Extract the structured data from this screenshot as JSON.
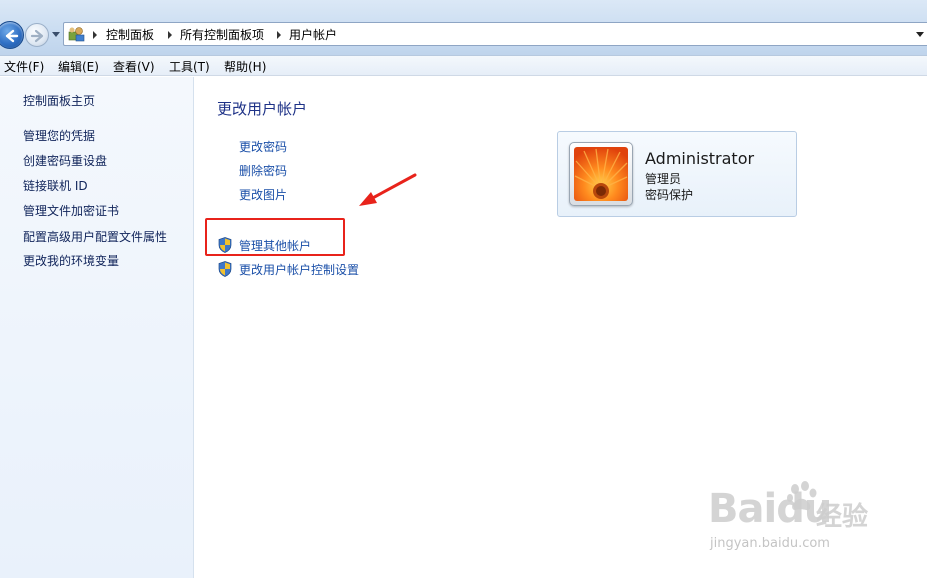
{
  "address_bar": {
    "breadcrumbs": [
      "控制面板",
      "所有控制面板项",
      "用户帐户"
    ]
  },
  "menu": {
    "items": [
      "文件(F)",
      "编辑(E)",
      "查看(V)",
      "工具(T)",
      "帮助(H)"
    ]
  },
  "sidebar": {
    "home": "控制面板主页",
    "links": [
      "管理您的凭据",
      "创建密码重设盘",
      "链接联机 ID",
      "管理文件加密证书",
      "配置高级用户配置文件属性",
      "更改我的环境变量"
    ]
  },
  "main": {
    "title": "更改用户帐户",
    "tasks": [
      "更改密码",
      "删除密码",
      "更改图片"
    ],
    "admin_tasks": [
      "管理其他帐户",
      "更改用户帐户控制设置"
    ]
  },
  "account": {
    "name": "Administrator",
    "role": "管理员",
    "status": "密码保护"
  },
  "watermark": {
    "brand": "Baidu",
    "brand_cn": "经验",
    "url": "jingyan.baidu.com"
  },
  "colors": {
    "link": "#1a4fa8",
    "title": "#1e3287",
    "annotation": "#e8231b"
  }
}
